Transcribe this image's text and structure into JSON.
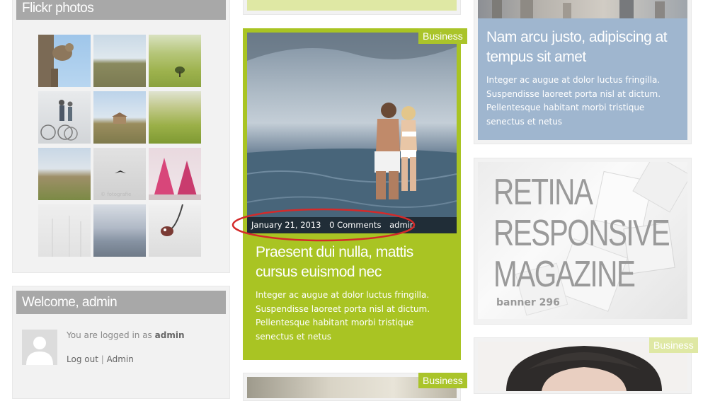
{
  "flickr": {
    "title": "Flickr photos",
    "photos": [
      "squirrel",
      "green hill",
      "field tree",
      "bikes fog",
      "farmhouse",
      "tuscany fields",
      "rolling hills",
      "gull sky",
      "pink trees",
      "mist trees",
      "mountains",
      "water drop"
    ]
  },
  "welcome": {
    "title": "Welcome, admin",
    "logged_in_text": "You are logged in as",
    "username": "admin",
    "logout_label": "Log out",
    "separator": "|",
    "admin_label": "Admin"
  },
  "feature_post": {
    "category": "Business",
    "date": "January 21, 2013",
    "comments": "0 Comments",
    "author": "admin",
    "title": "Praesent dui nulla, mattis cursus euismod nec",
    "excerpt": "Integer ac augue at dolor luctus fringilla. Suspendisse laoreet porta nisl at dictum. Pellentesque habitant morbi tristique senectus et netus"
  },
  "bottom_post": {
    "category": "Business"
  },
  "right_post": {
    "title": "Nam arcu justo, adipiscing at tempus sit amet",
    "excerpt": "Integer ac augue at dolor luctus fringilla. Suspendisse laoreet porta nisl at dictum. Pellentesque habitant morbi tristique senectus et netus"
  },
  "banner": {
    "line1": "RETINA",
    "line2": "RESPONSIVE",
    "line3": "MAGAZINE",
    "caption": "banner 296"
  },
  "portrait_post": {
    "category": "Business"
  },
  "colors": {
    "accent_green": "#a9c423",
    "sidebar_title_gray": "#a8a8a8",
    "right_post_blue": "#9fb6cf",
    "annotation_red": "#d42a2a"
  }
}
